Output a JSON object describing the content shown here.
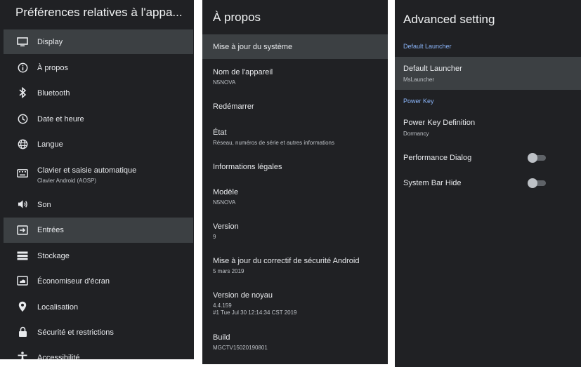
{
  "left": {
    "title": "Préférences relatives à l'appa...",
    "items": [
      {
        "label": "Display",
        "icon": "monitor-icon"
      },
      {
        "label": "À propos",
        "icon": "info-icon"
      },
      {
        "label": "Bluetooth",
        "icon": "bluetooth-icon"
      },
      {
        "label": "Date et heure",
        "icon": "clock-icon"
      },
      {
        "label": "Langue",
        "icon": "globe-icon"
      },
      {
        "label": "Clavier et saisie automatique",
        "sub": "Clavier Android (AOSP)",
        "icon": "keyboard-icon"
      },
      {
        "label": "Son",
        "icon": "speaker-icon"
      },
      {
        "label": "Entrées",
        "icon": "input-icon"
      },
      {
        "label": "Stockage",
        "icon": "storage-icon"
      },
      {
        "label": "Économiseur d'écran",
        "icon": "screensaver-icon"
      },
      {
        "label": "Localisation",
        "icon": "location-pin-icon"
      },
      {
        "label": "Sécurité et restrictions",
        "icon": "lock-icon"
      },
      {
        "label": "Accessibilité",
        "icon": "accessibility-icon"
      }
    ]
  },
  "mid": {
    "title": "À propos",
    "items": [
      {
        "label": "Mise à jour du système"
      },
      {
        "label": "Nom de l'appareil",
        "sub": "N5NOVA"
      },
      {
        "label": "Redémarrer"
      },
      {
        "label": "État",
        "sub": "Réseau, numéros de série et autres informations"
      },
      {
        "label": "Informations légales"
      },
      {
        "label": "Modèle",
        "sub": "N5NOVA"
      },
      {
        "label": "Version",
        "sub": "9"
      },
      {
        "label": "Mise à jour du correctif de sécurité Android",
        "sub": "5 mars 2019"
      },
      {
        "label": "Version de noyau",
        "sub": "4.4.159",
        "sub2": "#1 Tue Jul 30 12:14:34 CST 2019"
      },
      {
        "label": "Build",
        "sub": "MGCTV15020190801"
      }
    ]
  },
  "right": {
    "title": "Advanced setting",
    "section1": "Default Launcher",
    "section2": "Power Key",
    "items": [
      {
        "label": "Default Launcher",
        "sub": "MsLauncher"
      },
      {
        "label": "Power Key Definition",
        "sub": "Dormancy"
      },
      {
        "label": "Performance Dialog",
        "toggle": "off"
      },
      {
        "label": "System Bar Hide",
        "toggle": "off"
      }
    ]
  },
  "colors": {
    "panel_bg": "#202124",
    "highlight": "#3c4043",
    "accent": "#8ab4f8"
  }
}
